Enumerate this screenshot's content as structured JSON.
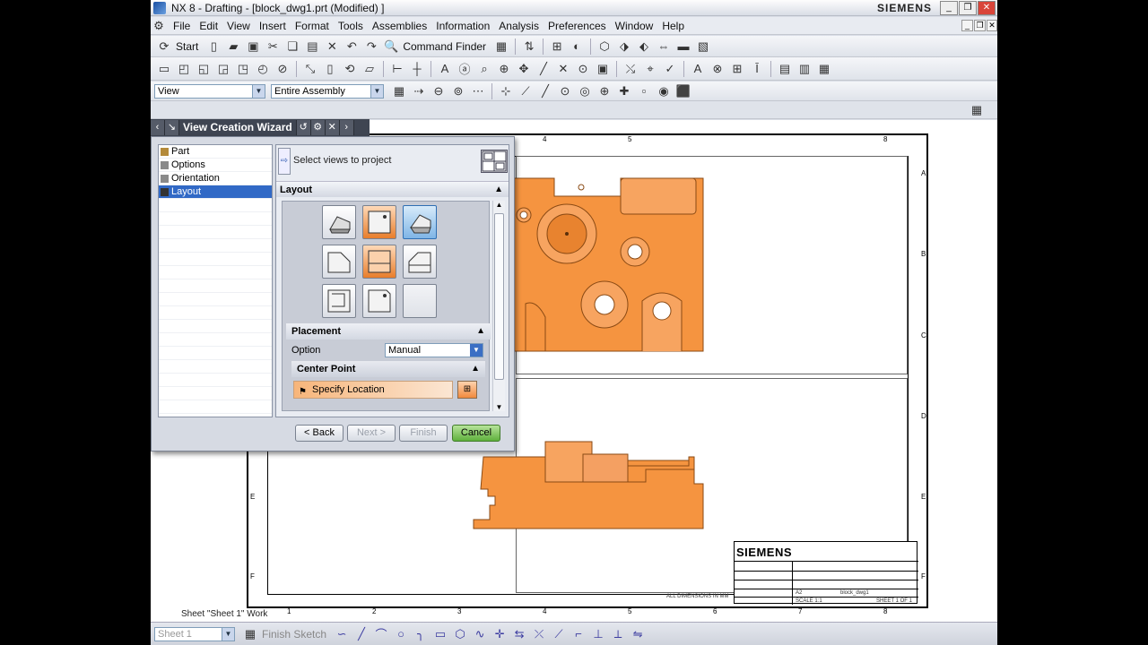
{
  "window": {
    "title": "NX 8 - Drafting - [block_dwg1.prt (Modified) ]",
    "brand": "SIEMENS"
  },
  "menu": [
    "File",
    "Edit",
    "View",
    "Insert",
    "Format",
    "Tools",
    "Assemblies",
    "Information",
    "Analysis",
    "Preferences",
    "Window",
    "Help"
  ],
  "toolbar": {
    "start_label": "Start",
    "command_finder_label": "Command Finder",
    "view_combo": "View",
    "assembly_combo": "Entire Assembly"
  },
  "wizard": {
    "title": "View Creation Wizard",
    "steps": [
      "Part",
      "Options",
      "Orientation",
      "Layout"
    ],
    "selected_step": "Layout",
    "select_views_label": "Select views to project",
    "layout_section": "Layout",
    "placement_section": "Placement",
    "option_label": "Option",
    "option_value": "Manual",
    "center_point_section": "Center Point",
    "specify_location": "Specify Location",
    "buttons": {
      "back": "< Back",
      "next": "Next >",
      "finish": "Finish",
      "cancel": "Cancel"
    }
  },
  "drawing": {
    "zone_top": [
      "4",
      "5",
      "8"
    ],
    "zone_bottom": [
      "1",
      "2",
      "3",
      "4",
      "5",
      "6",
      "7",
      "8"
    ],
    "zone_right": [
      "A",
      "B",
      "C",
      "D",
      "E",
      "F"
    ],
    "zone_left": [
      "E",
      "F"
    ],
    "dimensions_note": "ALL DIMENSIONS IN MM",
    "title_block": {
      "company": "SIEMENS",
      "drawing_name": "block_dwg1",
      "sheet": "SHEET 1 OF 1",
      "size": "A2",
      "scale": "SCALE 1:1"
    },
    "part_color": "#f59440"
  },
  "status": {
    "sheet_text": "Sheet \"Sheet 1\" Work",
    "sheet_combo": "Sheet 1",
    "finish_sketch": "Finish Sketch"
  }
}
